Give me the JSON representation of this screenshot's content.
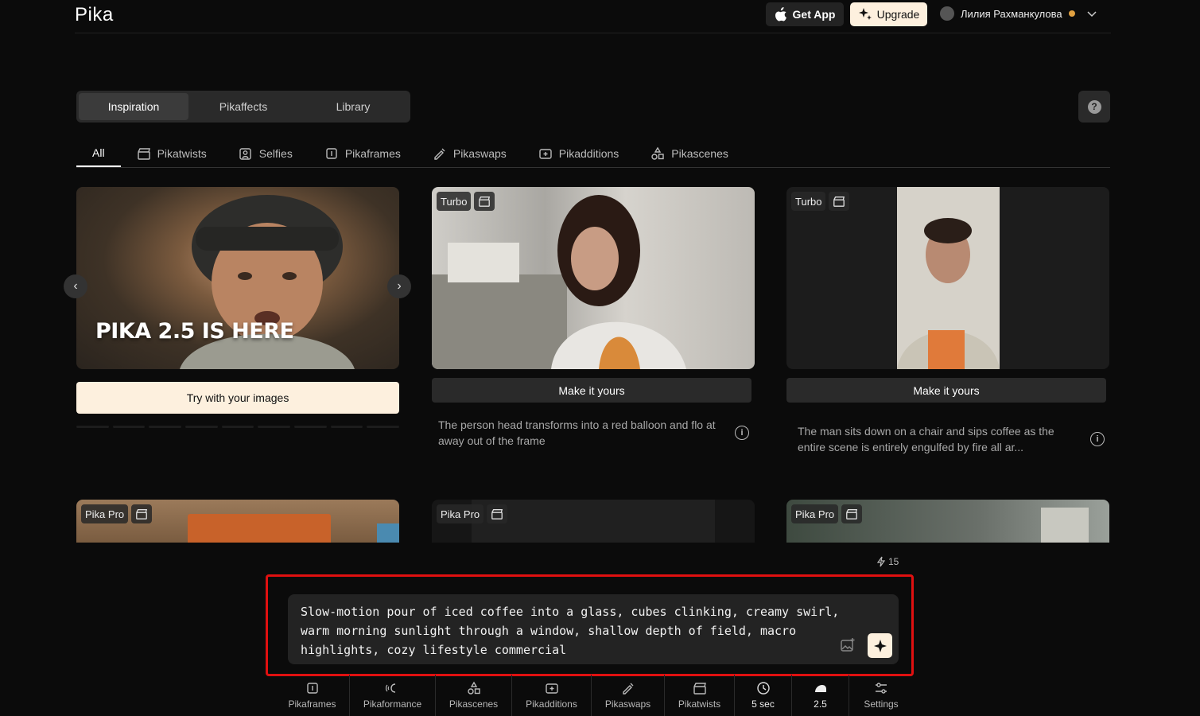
{
  "header": {
    "logo": "Pika",
    "get_app": "Get App",
    "upgrade": "Upgrade",
    "user_name": "Лилия Рахманкулова"
  },
  "main_tabs": [
    {
      "label": "Inspiration",
      "active": true
    },
    {
      "label": "Pikaffects",
      "active": false
    },
    {
      "label": "Library",
      "active": false
    }
  ],
  "help_label": "?",
  "filter_tabs": [
    {
      "label": "All",
      "icon": "none",
      "active": true
    },
    {
      "label": "Pikatwists",
      "icon": "clapper-icon"
    },
    {
      "label": "Selfies",
      "icon": "selfie-icon"
    },
    {
      "label": "Pikaframes",
      "icon": "frames-icon"
    },
    {
      "label": "Pikaswaps",
      "icon": "swap-icon"
    },
    {
      "label": "Pikadditions",
      "icon": "add-icon"
    },
    {
      "label": "Pikascenes",
      "icon": "shapes-icon"
    }
  ],
  "hero": {
    "title": "PIKA 2.5 IS HERE",
    "button": "Try with your images",
    "prev": "‹",
    "next": "›"
  },
  "cards": [
    {
      "badge": "Turbo",
      "button": "Make it yours",
      "description": "The person head transforms into a red balloon and flo at away out of the frame"
    },
    {
      "badge": "Turbo",
      "button": "Make it yours",
      "description": "The man sits down on a chair and sips coffee as the entire scene is entirely engulfed by fire all ar..."
    }
  ],
  "row2_badges": [
    "Pika Pro",
    "Pika Pro",
    "Pika Pro"
  ],
  "info_glyph": "i",
  "credits": "15",
  "prompt": {
    "text": "Slow-motion pour of iced coffee into a glass, cubes clinking, creamy swirl, warm morning sunlight through a window, shallow depth of field, macro highlights, cozy lifestyle commercial"
  },
  "toolbar": [
    {
      "label": "Pikaframes",
      "icon": "frames-icon"
    },
    {
      "label": "Pikaformance",
      "icon": "performance-icon"
    },
    {
      "label": "Pikascenes",
      "icon": "shapes-icon"
    },
    {
      "label": "Pikadditions",
      "icon": "add-icon"
    },
    {
      "label": "Pikaswaps",
      "icon": "swap-icon"
    },
    {
      "label": "Pikatwists",
      "icon": "clapper-icon"
    },
    {
      "label": "5 sec",
      "icon": "clock-icon"
    },
    {
      "label": "2.5",
      "icon": "model-icon"
    },
    {
      "label": "Settings",
      "icon": "sliders-icon"
    }
  ],
  "colors": {
    "accent": "#fdf0de",
    "highlight": "#e01010",
    "background": "#0b0b0b"
  }
}
